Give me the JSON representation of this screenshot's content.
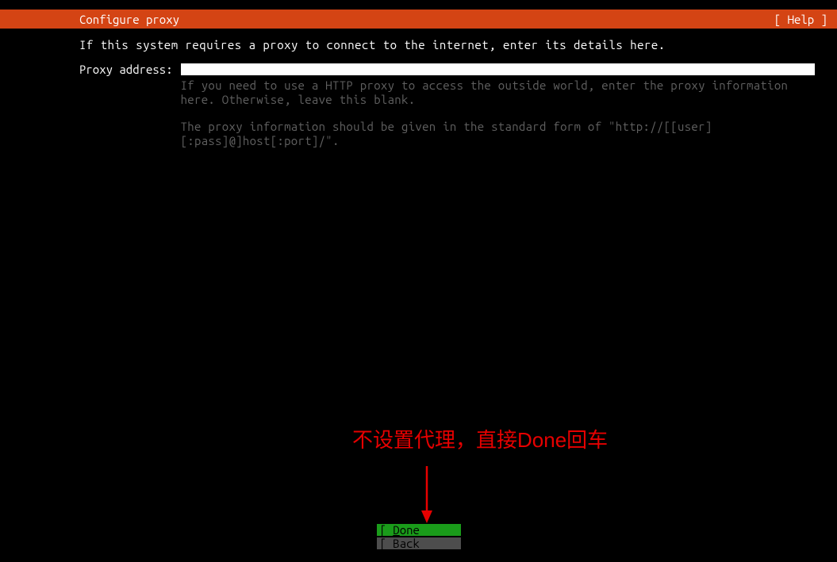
{
  "header": {
    "title": "Configure proxy",
    "help": "[ Help ]"
  },
  "intro": "If this system requires a proxy to connect to the internet, enter its details here.",
  "field": {
    "label": "Proxy address:",
    "value": "",
    "help1": "If you need to use a HTTP proxy to access the outside world, enter the proxy information here. Otherwise, leave this blank.",
    "help2": "The proxy information should be given in the standard form of \"http://[[user][:pass]@]host[:port]/\"."
  },
  "buttons": {
    "done_prefix": "[ ",
    "done_letter": "D",
    "done_rest": "one       ]",
    "back": "[ Back       ]"
  },
  "annotation": {
    "text": "不设置代理，直接Done回车"
  }
}
